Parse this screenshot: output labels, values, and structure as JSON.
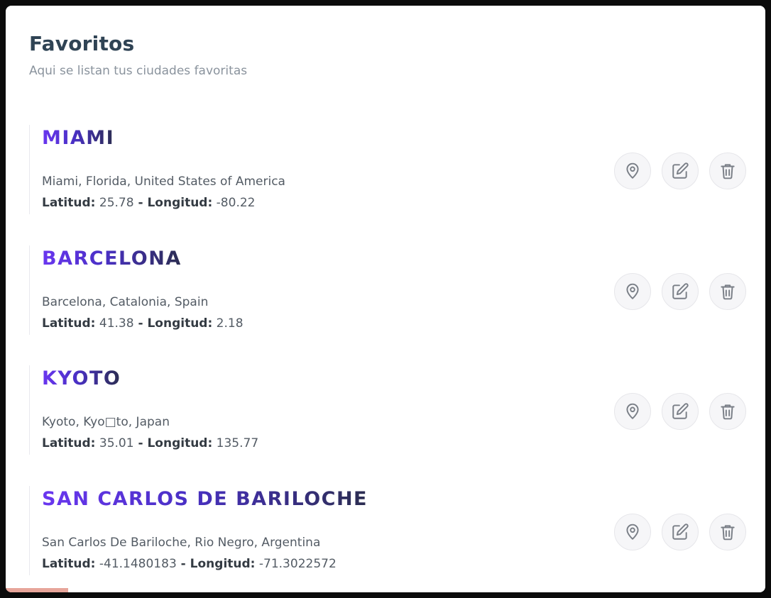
{
  "header": {
    "title": "Favoritos",
    "subtitle": "Aqui se listan tus ciudades favoritas"
  },
  "labels": {
    "latitude": "Latitud:",
    "separator": " - ",
    "longitude": "Longitud:"
  },
  "favorites": [
    {
      "name": "MIAMI",
      "location": "Miami, Florida, United States of America",
      "latitude": "25.78",
      "longitude": "-80.22"
    },
    {
      "name": "BARCELONA",
      "location": "Barcelona, Catalonia, Spain",
      "latitude": "41.38",
      "longitude": "2.18"
    },
    {
      "name": "KYOTO",
      "location": "Kyoto, Kyo□to, Japan",
      "latitude": "35.01",
      "longitude": "135.77"
    },
    {
      "name": "SAN CARLOS DE BARILOCHE",
      "location": "San Carlos De Bariloche, Rio Negro, Argentina",
      "latitude": "-41.1480183",
      "longitude": "-71.3022572"
    }
  ],
  "actions": {
    "icons": [
      "map-pin-icon",
      "edit-icon",
      "trash-icon"
    ]
  },
  "colors": {
    "title": "#2f4354",
    "city_name_start": "#6a36f0",
    "city_name_end": "#2b2d50",
    "icon": "#7a7f87",
    "button_bg": "#f6f6f8"
  }
}
